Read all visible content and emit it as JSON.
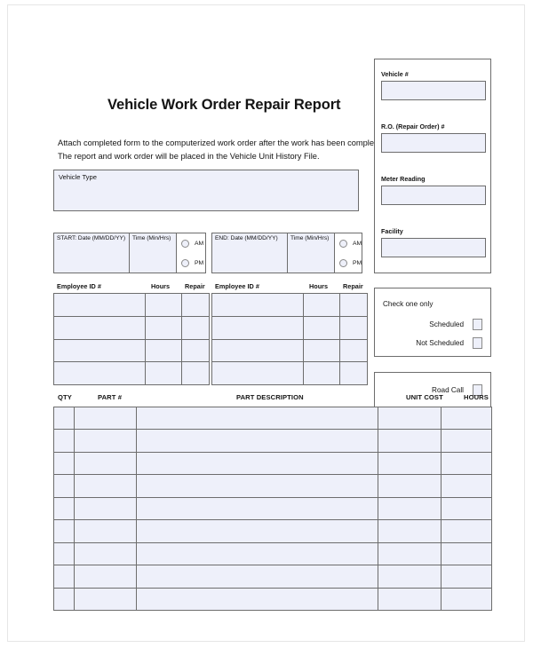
{
  "form": {
    "title": "Vehicle Work Order Repair Report",
    "intro_line1": "Attach completed form to the computerized work order after the work has been completed.",
    "intro_line2": "The report and work order will be placed in the Vehicle Unit History File.",
    "vehicle_type_label": "Vehicle Type",
    "vehicle_type_value": ""
  },
  "colors": {
    "field_fill": "#eef0fa",
    "border": "#6d6d6d",
    "text": "#141414"
  },
  "start_block": {
    "date_label": "START: Date (MM/DD/YY)",
    "date_value": "",
    "time_label": "Time (Min/Hrs)",
    "time_value": "",
    "am_label": "AM",
    "pm_label": "PM",
    "am_checked": false,
    "pm_checked": false
  },
  "end_block": {
    "date_label": "END: Date (MM/DD/YY)",
    "date_value": "",
    "time_label": "Time (Min/Hrs)",
    "time_value": "",
    "am_label": "AM",
    "pm_label": "PM",
    "am_checked": false,
    "pm_checked": false
  },
  "employee_table_left": {
    "headers": [
      "Employee ID #",
      "Hours",
      "Repair"
    ],
    "rows": [
      [
        "",
        "",
        ""
      ],
      [
        "",
        "",
        ""
      ],
      [
        "",
        "",
        ""
      ],
      [
        "",
        "",
        ""
      ]
    ]
  },
  "employee_table_right": {
    "headers": [
      "Employee ID #",
      "Hours",
      "Repair"
    ],
    "rows": [
      [
        "",
        "",
        ""
      ],
      [
        "",
        "",
        ""
      ],
      [
        "",
        "",
        ""
      ],
      [
        "",
        "",
        ""
      ]
    ]
  },
  "sidebar": {
    "fields": [
      {
        "label": "Vehicle #",
        "value": ""
      },
      {
        "label": "R.O. (Repair Order) #",
        "value": ""
      },
      {
        "label": "Meter Reading",
        "value": ""
      },
      {
        "label": "Facility",
        "value": ""
      }
    ]
  },
  "check_panel": {
    "title": "Check one only",
    "options": [
      {
        "label": "Scheduled",
        "checked": false
      },
      {
        "label": "Not Scheduled",
        "checked": false
      }
    ]
  },
  "road_call": {
    "label": "Road Call",
    "checked": false
  },
  "parts_table": {
    "headers": [
      "QTY",
      "PART #",
      "PART DESCRIPTION",
      "UNIT COST",
      "HOURS"
    ],
    "row_count": 9,
    "rows": [
      [
        "",
        "",
        "",
        "",
        ""
      ],
      [
        "",
        "",
        "",
        "",
        ""
      ],
      [
        "",
        "",
        "",
        "",
        ""
      ],
      [
        "",
        "",
        "",
        "",
        ""
      ],
      [
        "",
        "",
        "",
        "",
        ""
      ],
      [
        "",
        "",
        "",
        "",
        ""
      ],
      [
        "",
        "",
        "",
        "",
        ""
      ],
      [
        "",
        "",
        "",
        "",
        ""
      ],
      [
        "",
        "",
        "",
        "",
        ""
      ]
    ]
  }
}
